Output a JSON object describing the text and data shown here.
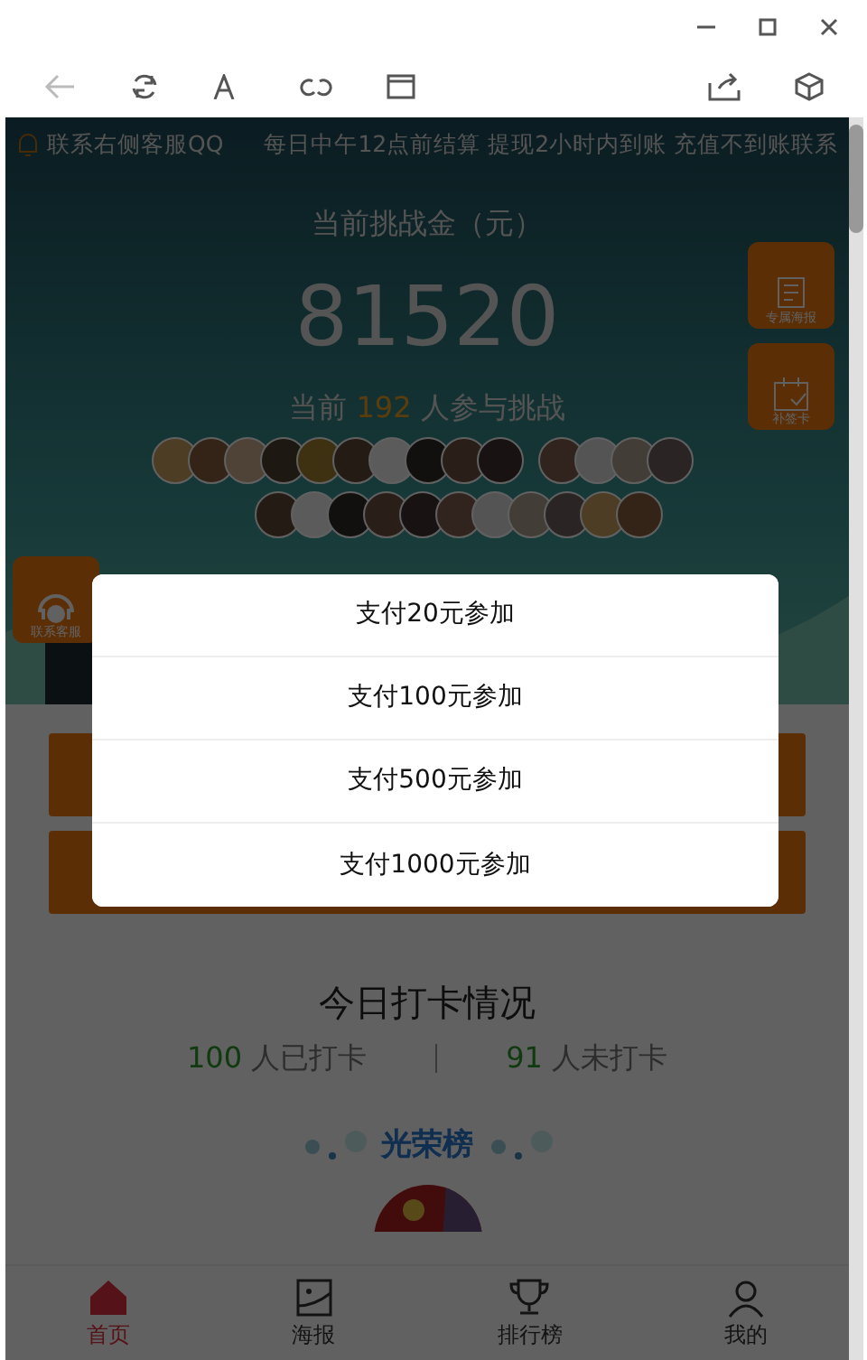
{
  "notice": {
    "left": "联系右侧客服QQ",
    "right": "每日中午12点前结算 提现2小时内到账 充值不到账联系"
  },
  "challenge": {
    "title": "当前挑战金（元）",
    "amount": "81520",
    "prefix": "当前",
    "count": "192",
    "suffix": "人参与挑战"
  },
  "side_buttons": [
    {
      "label": "专属海报"
    },
    {
      "label": "补签卡"
    }
  ],
  "service_button": {
    "label": "联系客服"
  },
  "checkin": {
    "title": "今日打卡情况",
    "stats": [
      {
        "count": "100",
        "label": "人已打卡"
      },
      {
        "count": "91",
        "label": "人未打卡"
      }
    ]
  },
  "honor": {
    "title": "光荣榜"
  },
  "tabbar": [
    {
      "label": "首页",
      "selected": true
    },
    {
      "label": "海报",
      "selected": false
    },
    {
      "label": "排行榜",
      "selected": false
    },
    {
      "label": "我的",
      "selected": false
    }
  ],
  "modal": {
    "options": [
      "支付20元参加",
      "支付100元参加",
      "支付500元参加",
      "支付1000元参加"
    ]
  }
}
